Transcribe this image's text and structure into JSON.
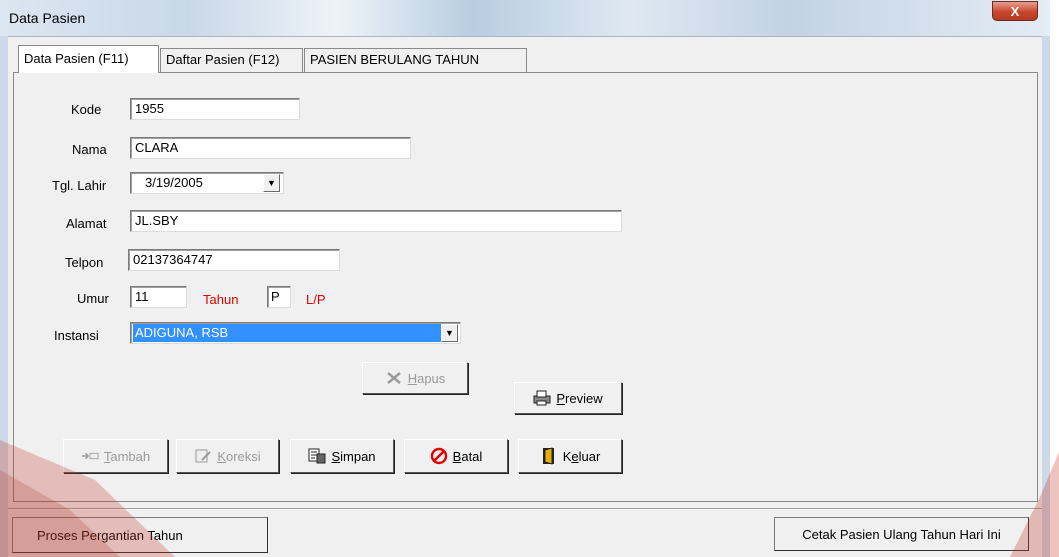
{
  "window": {
    "title": "Data Pasien",
    "close_glyph": "X"
  },
  "tabs": [
    {
      "label": "Data Pasien (F11)"
    },
    {
      "label": "Daftar Pasien (F12)"
    },
    {
      "label": "PASIEN BERULANG TAHUN"
    }
  ],
  "form": {
    "kode": {
      "label": "Kode",
      "value": "1955"
    },
    "nama": {
      "label": "Nama",
      "value": "CLARA"
    },
    "tgl_lahir": {
      "label": "Tgl. Lahir",
      "value": "3/19/2005"
    },
    "alamat": {
      "label": "Alamat",
      "value": "JL.SBY"
    },
    "telpon": {
      "label": "Telpon",
      "value": "02137364747"
    },
    "umur": {
      "label": "Umur",
      "value": "11",
      "unit": "Tahun"
    },
    "jenis_kelamin": {
      "value": "P",
      "hint": "L/P"
    },
    "instansi": {
      "label": "Instansi",
      "value": "ADIGUNA, RSB"
    }
  },
  "buttons": {
    "hapus": {
      "pre": "",
      "key": "H",
      "rest": "apus"
    },
    "preview": {
      "key": "P",
      "rest": "review"
    },
    "tambah": {
      "key": "T",
      "rest": "ambah"
    },
    "koreksi": {
      "key": "K",
      "rest": "oreksi"
    },
    "simpan": {
      "key": "S",
      "rest": "impan"
    },
    "batal": {
      "key": "B",
      "rest": "atal"
    },
    "keluar": {
      "pre": "K",
      "key": "e",
      "rest": "luar"
    },
    "proses": "Proses Pergantian Tahun",
    "cetak": "Cetak Pasien Ulang Tahun Hari Ini"
  },
  "colors": {
    "accent_red": "#e00000",
    "selection": "#3390ff",
    "watermark": "#c0392b"
  }
}
